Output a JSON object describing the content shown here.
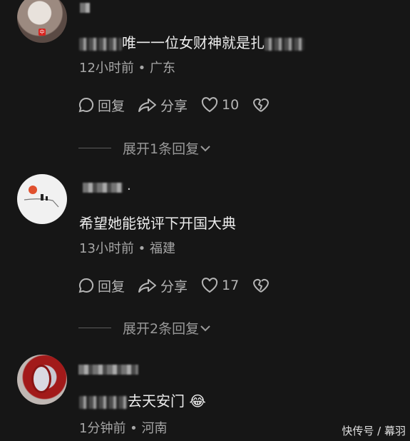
{
  "comments": [
    {
      "text_visible": "唯一一位女财神就是扎",
      "time": "12小时前",
      "location": "广东",
      "reply_label": "回复",
      "share_label": "分享",
      "likes": "10",
      "expand": "展开1条回复"
    },
    {
      "username_suffix": ".",
      "text": "希望她能锐评下开国大典",
      "time": "13小时前",
      "location": "福建",
      "reply_label": "回复",
      "share_label": "分享",
      "likes": "17",
      "expand": "展开2条回复"
    },
    {
      "text_visible": "去天安门",
      "emoji": "😂",
      "time": "1分钟前",
      "location": "河南"
    }
  ],
  "separator": " • ",
  "watermark": "快传号 / 幕羽",
  "avatar_badge": "中",
  "icons": [
    "chat-bubble-icon",
    "share-arrow-icon",
    "heart-icon",
    "broken-heart-icon",
    "chevron-down-icon"
  ]
}
